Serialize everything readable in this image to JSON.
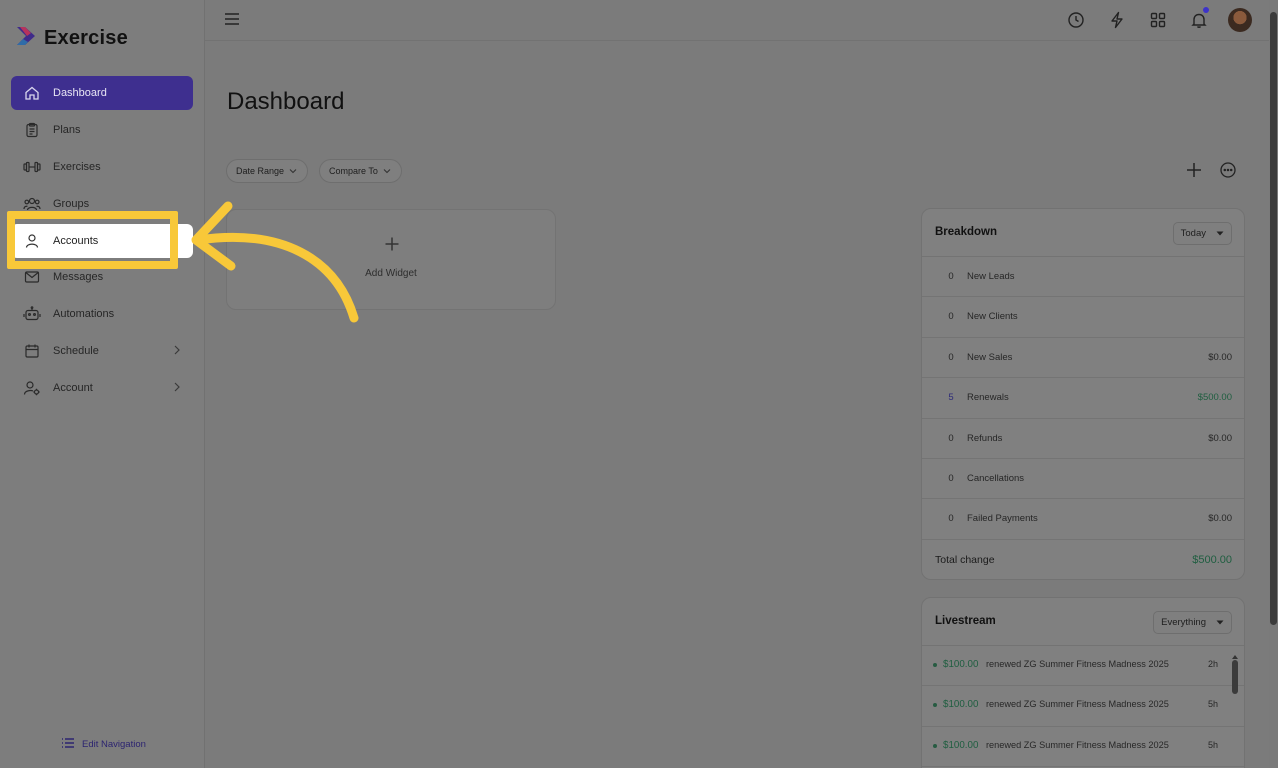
{
  "brand": {
    "name": "Exercise"
  },
  "sidebar": {
    "items": [
      {
        "label": "Dashboard",
        "icon": "home-icon",
        "state": "active"
      },
      {
        "label": "Plans",
        "icon": "clipboard-icon"
      },
      {
        "label": "Exercises",
        "icon": "dumbbell-icon"
      },
      {
        "label": "Groups",
        "icon": "users-icon"
      },
      {
        "label": "Accounts",
        "icon": "user-icon",
        "state": "highlighted"
      },
      {
        "label": "Messages",
        "icon": "mail-icon"
      },
      {
        "label": "Automations",
        "icon": "robot-icon"
      },
      {
        "label": "Schedule",
        "icon": "calendar-icon",
        "has_submenu": true
      },
      {
        "label": "Account",
        "icon": "user-settings-icon",
        "has_submenu": true
      }
    ],
    "edit_navigation_label": "Edit Navigation"
  },
  "main": {
    "title": "Dashboard",
    "filters": {
      "date_range": "Date Range",
      "compare_to": "Compare To"
    },
    "add_widget_label": "Add Widget"
  },
  "breakdown": {
    "title": "Breakdown",
    "period": "Today",
    "rows": [
      {
        "count": "0",
        "label": "New Leads",
        "amount": ""
      },
      {
        "count": "0",
        "label": "New Clients",
        "amount": ""
      },
      {
        "count": "0",
        "label": "New Sales",
        "amount": "$0.00"
      },
      {
        "count": "5",
        "label": "Renewals",
        "amount": "$500.00"
      },
      {
        "count": "0",
        "label": "Refunds",
        "amount": "$0.00"
      },
      {
        "count": "0",
        "label": "Cancellations",
        "amount": ""
      },
      {
        "count": "0",
        "label": "Failed Payments",
        "amount": "$0.00"
      }
    ],
    "total_label": "Total change",
    "total_amount": "$500.00"
  },
  "livestream": {
    "title": "Livestream",
    "filter": "Everything",
    "events": [
      {
        "amount": "$100.00",
        "text": "renewed ZG Summer Fitness Madness 2025",
        "time": "2h"
      },
      {
        "amount": "$100.00",
        "text": "renewed ZG Summer Fitness Madness 2025",
        "time": "5h"
      },
      {
        "amount": "$100.00",
        "text": "renewed ZG Summer Fitness Madness 2025",
        "time": "5h"
      }
    ]
  },
  "colors": {
    "active_nav": "#3e2f8f",
    "highlight": "#f8c839",
    "positive_amount": "#1f5e40",
    "notification_dot": "#3d33c9"
  }
}
